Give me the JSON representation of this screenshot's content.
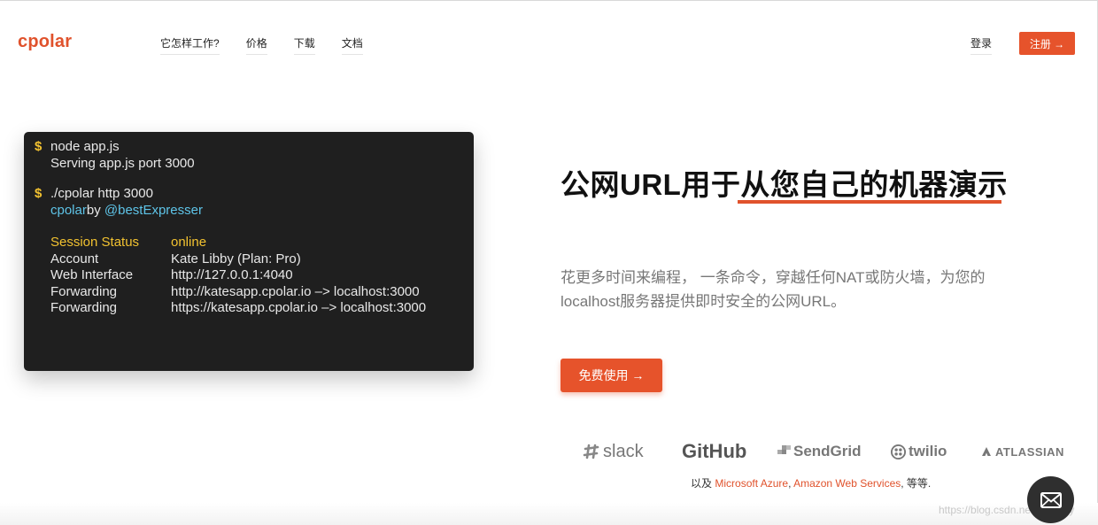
{
  "header": {
    "logo": "cpolar",
    "nav": [
      "它怎样工作?",
      "价格",
      "下载",
      "文档"
    ],
    "login": "登录",
    "register": "注册 →"
  },
  "terminal": {
    "cmd1": "node app.js",
    "out1": "Serving app.js port 3000",
    "cmd2": "./cpolar http 3000",
    "by_name": "cpolar",
    "by_word": "by",
    "by_user": "@bestExpresser",
    "rows": [
      {
        "key": "Session Status",
        "value": "online"
      },
      {
        "key": "Account",
        "value": "Kate Libby (Plan: Pro)"
      },
      {
        "key": "Web Interface",
        "value": "http://127.0.0.1:4040"
      },
      {
        "key": "Forwarding",
        "value": "http://katesapp.cpolar.io –> localhost:3000"
      },
      {
        "key": "Forwarding",
        "value": "https://katesapp.cpolar.io –> localhost:3000"
      }
    ]
  },
  "hero": {
    "headline": "公网URL用于从您自己的机器演示",
    "subtext": "花更多时间来编程， 一条命令，穿越任何NAT或防火墙，为您的localhost服务器提供即时安全的公网URL。",
    "cta": "免费使用 →"
  },
  "partners": {
    "logos": [
      "slack",
      "GitHub",
      "SendGrid",
      "twilio",
      "ATLASSIAN"
    ],
    "prefix": "以及",
    "azure": "Microsoft Azure",
    "aws": "Amazon Web Services",
    "suffix": ", 等等."
  },
  "watermark": "https://blog.csdn.net/probezy"
}
